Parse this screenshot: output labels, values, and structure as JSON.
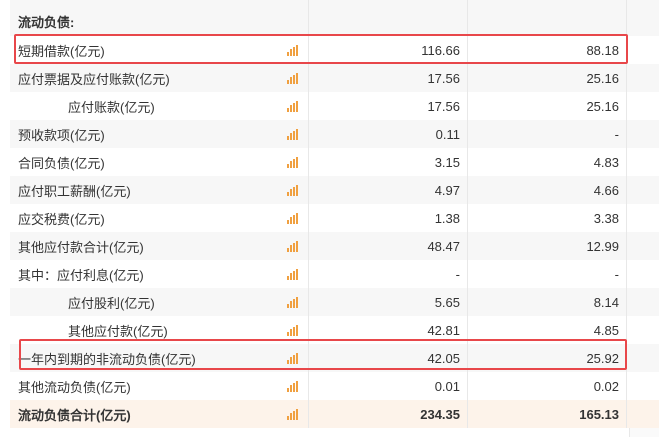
{
  "section_title": "流动负债:",
  "rows": [
    {
      "label": "短期借款(亿元)",
      "v1": "116.66",
      "v2": "88.18",
      "indent": false,
      "total": false
    },
    {
      "label": "应付票据及应付账款(亿元)",
      "v1": "17.56",
      "v2": "25.16",
      "indent": false,
      "total": false
    },
    {
      "label": "应付账款(亿元)",
      "v1": "17.56",
      "v2": "25.16",
      "indent": true,
      "total": false
    },
    {
      "label": "预收款项(亿元)",
      "v1": "0.11",
      "v2": "-",
      "indent": false,
      "total": false
    },
    {
      "label": "合同负债(亿元)",
      "v1": "3.15",
      "v2": "4.83",
      "indent": false,
      "total": false
    },
    {
      "label": "应付职工薪酬(亿元)",
      "v1": "4.97",
      "v2": "4.66",
      "indent": false,
      "total": false
    },
    {
      "label": "应交税费(亿元)",
      "v1": "1.38",
      "v2": "3.38",
      "indent": false,
      "total": false
    },
    {
      "label": "其他应付款合计(亿元)",
      "v1": "48.47",
      "v2": "12.99",
      "indent": false,
      "total": false
    },
    {
      "label": "其中：应付利息(亿元)",
      "v1": "-",
      "v2": "-",
      "indent": false,
      "total": false
    },
    {
      "label": "应付股利(亿元)",
      "v1": "5.65",
      "v2": "8.14",
      "indent": true,
      "total": false
    },
    {
      "label": "其他应付款(亿元)",
      "v1": "42.81",
      "v2": "4.85",
      "indent": true,
      "total": false
    },
    {
      "label": "一年内到期的非流动负债(亿元)",
      "v1": "42.05",
      "v2": "25.92",
      "indent": false,
      "total": false
    },
    {
      "label": "其他流动负债(亿元)",
      "v1": "0.01",
      "v2": "0.02",
      "indent": false,
      "total": false
    },
    {
      "label": "流动负债合计(亿元)",
      "v1": "234.35",
      "v2": "165.13",
      "indent": false,
      "total": true
    }
  ],
  "colors": {
    "highlight": "#e8474a",
    "chart_icon": "#f0a040",
    "total_bg": "#fdf3ea"
  },
  "icons": {
    "row_chart": "bar-chart-icon"
  }
}
